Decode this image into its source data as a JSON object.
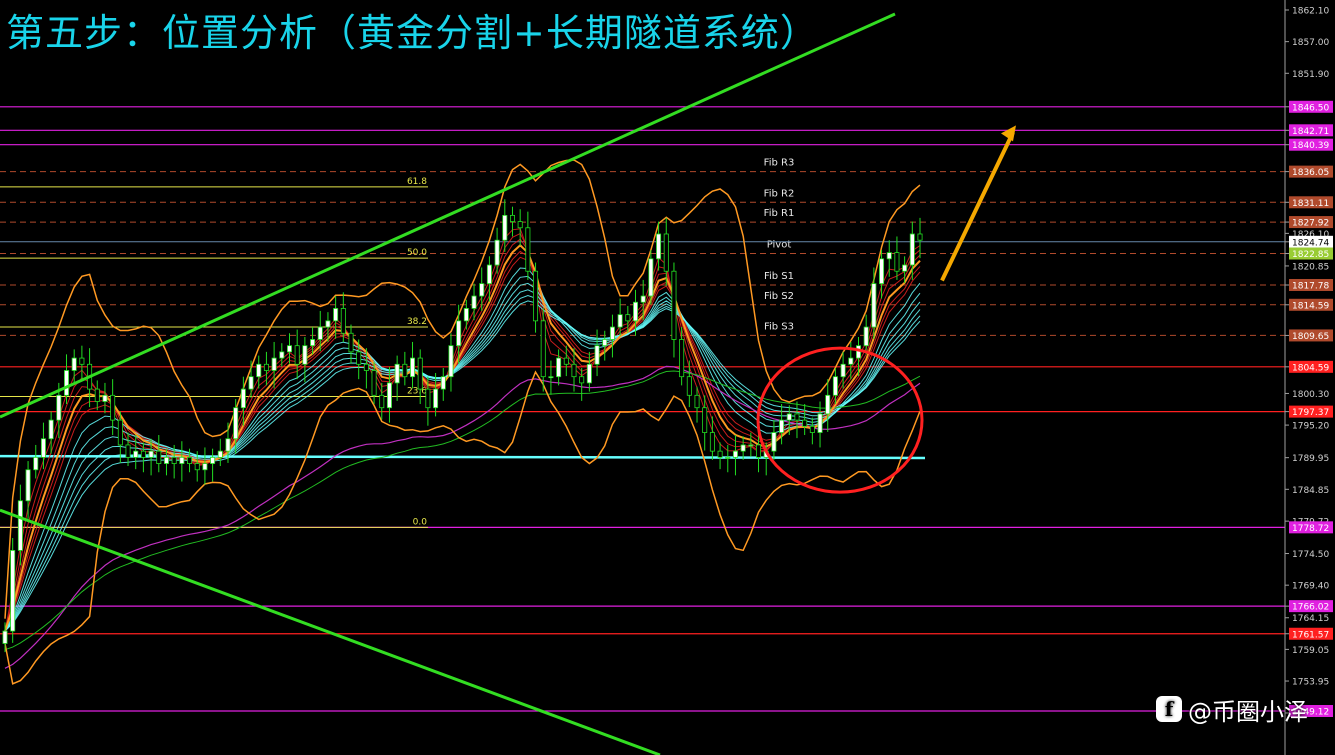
{
  "title": "第五步：位置分析（黄金分割+长期隧道系统）",
  "watermark": {
    "logo_glyph": "f",
    "text": "@币圈小泽"
  },
  "colors": {
    "background": "#000000",
    "title": "#19d4ea",
    "axis": "#a0a0a0",
    "fib": "#e6e64a",
    "pivot_dashed": "#b04a2c",
    "magenta_level": "#e020e0",
    "red_level": "#ff2020",
    "trend_line": "#33dd22",
    "bollinger": "#ff9922",
    "tunnel": "#66ffff",
    "ma_red": "#dd2020",
    "ma_purple": "#c030c0",
    "ma_green": "#22bb22",
    "candle_up": "#ffffff",
    "candle_down": "#ffffff",
    "candle_wick": "#22dd22",
    "circle": "#ff2020",
    "arrow": "#f5a800"
  },
  "chart_data": {
    "type": "candlestick",
    "ylim": [
      1756.0,
      1862.1
    ],
    "y_ticks": [
      "1862.10",
      "1857.00",
      "1851.90",
      "1846.50",
      "1842.71",
      "1840.39",
      "1836.05",
      "1831.11",
      "1827.92",
      "1826.10",
      "1824.74",
      "1822.85",
      "1820.85",
      "1817.78",
      "1814.59",
      "1809.65",
      "1804.59",
      "1800.30",
      "1797.37",
      "1795.20",
      "1789.95",
      "1784.85",
      "1779.72",
      "1774.50",
      "1769.40",
      "1766.02",
      "1764.15",
      "1761.57",
      "1759.05",
      "1753.95",
      "1748.80"
    ],
    "price_tags": [
      {
        "price": 1846.5,
        "label": "1846.50",
        "color": "#e020e0"
      },
      {
        "price": 1842.71,
        "label": "1842.71",
        "color": "#e020e0"
      },
      {
        "price": 1840.39,
        "label": "1840.39",
        "color": "#e020e0"
      },
      {
        "price": 1836.05,
        "label": "1836.05",
        "color": "#b04a2c"
      },
      {
        "price": 1831.11,
        "label": "1831.11",
        "color": "#b04a2c"
      },
      {
        "price": 1827.92,
        "label": "1827.92",
        "color": "#b04a2c"
      },
      {
        "price": 1824.74,
        "label": "1824.74",
        "color": "#ffffff"
      },
      {
        "price": 1822.85,
        "label": "1822.85",
        "color": "#99cc33"
      },
      {
        "price": 1817.78,
        "label": "1817.78",
        "color": "#b04a2c"
      },
      {
        "price": 1814.59,
        "label": "1814.59",
        "color": "#b04a2c"
      },
      {
        "price": 1809.65,
        "label": "1809.65",
        "color": "#b04a2c"
      },
      {
        "price": 1804.59,
        "label": "1804.59",
        "color": "#ff2020"
      },
      {
        "price": 1797.37,
        "label": "1797.37",
        "color": "#ff2020"
      },
      {
        "price": 1778.72,
        "label": "1778.72",
        "color": "#e020e0"
      },
      {
        "price": 1766.02,
        "label": "1766.02",
        "color": "#e020e0"
      },
      {
        "price": 1761.57,
        "label": "1761.57",
        "color": "#ff2020"
      },
      {
        "price": 1749.12,
        "label": "1749.12",
        "color": "#e020e0"
      }
    ],
    "fib_levels": [
      {
        "label": "61.8",
        "price": 1833.6
      },
      {
        "label": "50.0",
        "price": 1822.1
      },
      {
        "label": "38.2",
        "price": 1811.0
      },
      {
        "label": "23.6",
        "price": 1799.8
      },
      {
        "label": "0.0",
        "price": 1778.72
      }
    ],
    "pivot_levels": [
      {
        "label": "Fib R3",
        "price": 1836.05
      },
      {
        "label": "Fib R2",
        "price": 1831.11
      },
      {
        "label": "Fib R1",
        "price": 1827.92
      },
      {
        "label": "Pivot",
        "price": 1822.85
      },
      {
        "label": "Fib S1",
        "price": 1817.78
      },
      {
        "label": "Fib S2",
        "price": 1814.59
      },
      {
        "label": "Fib S3",
        "price": 1809.65
      }
    ],
    "horizontal_levels": [
      {
        "price": 1846.5,
        "color": "#e020e0"
      },
      {
        "price": 1842.71,
        "color": "#e020e0"
      },
      {
        "price": 1840.39,
        "color": "#e020e0"
      },
      {
        "price": 1804.59,
        "color": "#ff2020"
      },
      {
        "price": 1797.37,
        "color": "#ff2020"
      },
      {
        "price": 1778.72,
        "color": "#e020e0"
      },
      {
        "price": 1766.02,
        "color": "#e020e0"
      },
      {
        "price": 1761.57,
        "color": "#ff2020"
      },
      {
        "price": 1749.12,
        "color": "#e020e0"
      }
    ],
    "last_price": 1824.74,
    "bars": 120,
    "close": [
      1762,
      1775,
      1783,
      1788,
      1790,
      1793,
      1796,
      1800,
      1804,
      1806,
      1805,
      1801,
      1799,
      1800,
      1796,
      1792,
      1790,
      1791,
      1790,
      1791,
      1789,
      1790,
      1789,
      1790,
      1789,
      1788,
      1789,
      1790,
      1791,
      1793,
      1798,
      1801,
      1803,
      1805,
      1804,
      1806,
      1807,
      1808,
      1805,
      1808,
      1809,
      1811,
      1812,
      1814,
      1810,
      1807,
      1805,
      1804,
      1800,
      1798,
      1802,
      1805,
      1803,
      1806,
      1801,
      1798,
      1801,
      1803,
      1808,
      1812,
      1814,
      1816,
      1818,
      1821,
      1825,
      1829,
      1828,
      1827,
      1820,
      1812,
      1803,
      1803,
      1806,
      1805,
      1803,
      1802,
      1805,
      1808,
      1809,
      1811,
      1813,
      1812,
      1815,
      1816,
      1822,
      1826,
      1820,
      1809,
      1803,
      1800,
      1798,
      1794,
      1791,
      1790,
      1790,
      1791,
      1792,
      1792,
      1790,
      1791,
      1794,
      1796,
      1797,
      1796,
      1795,
      1794,
      1797,
      1800,
      1803,
      1805,
      1806,
      1808,
      1811,
      1818,
      1822,
      1823,
      1820,
      1821,
      1826,
      1825
    ],
    "circle_center_price": 1796.0,
    "arrow": {
      "from_price": 1818.5,
      "to_price": 1843.5
    }
  }
}
